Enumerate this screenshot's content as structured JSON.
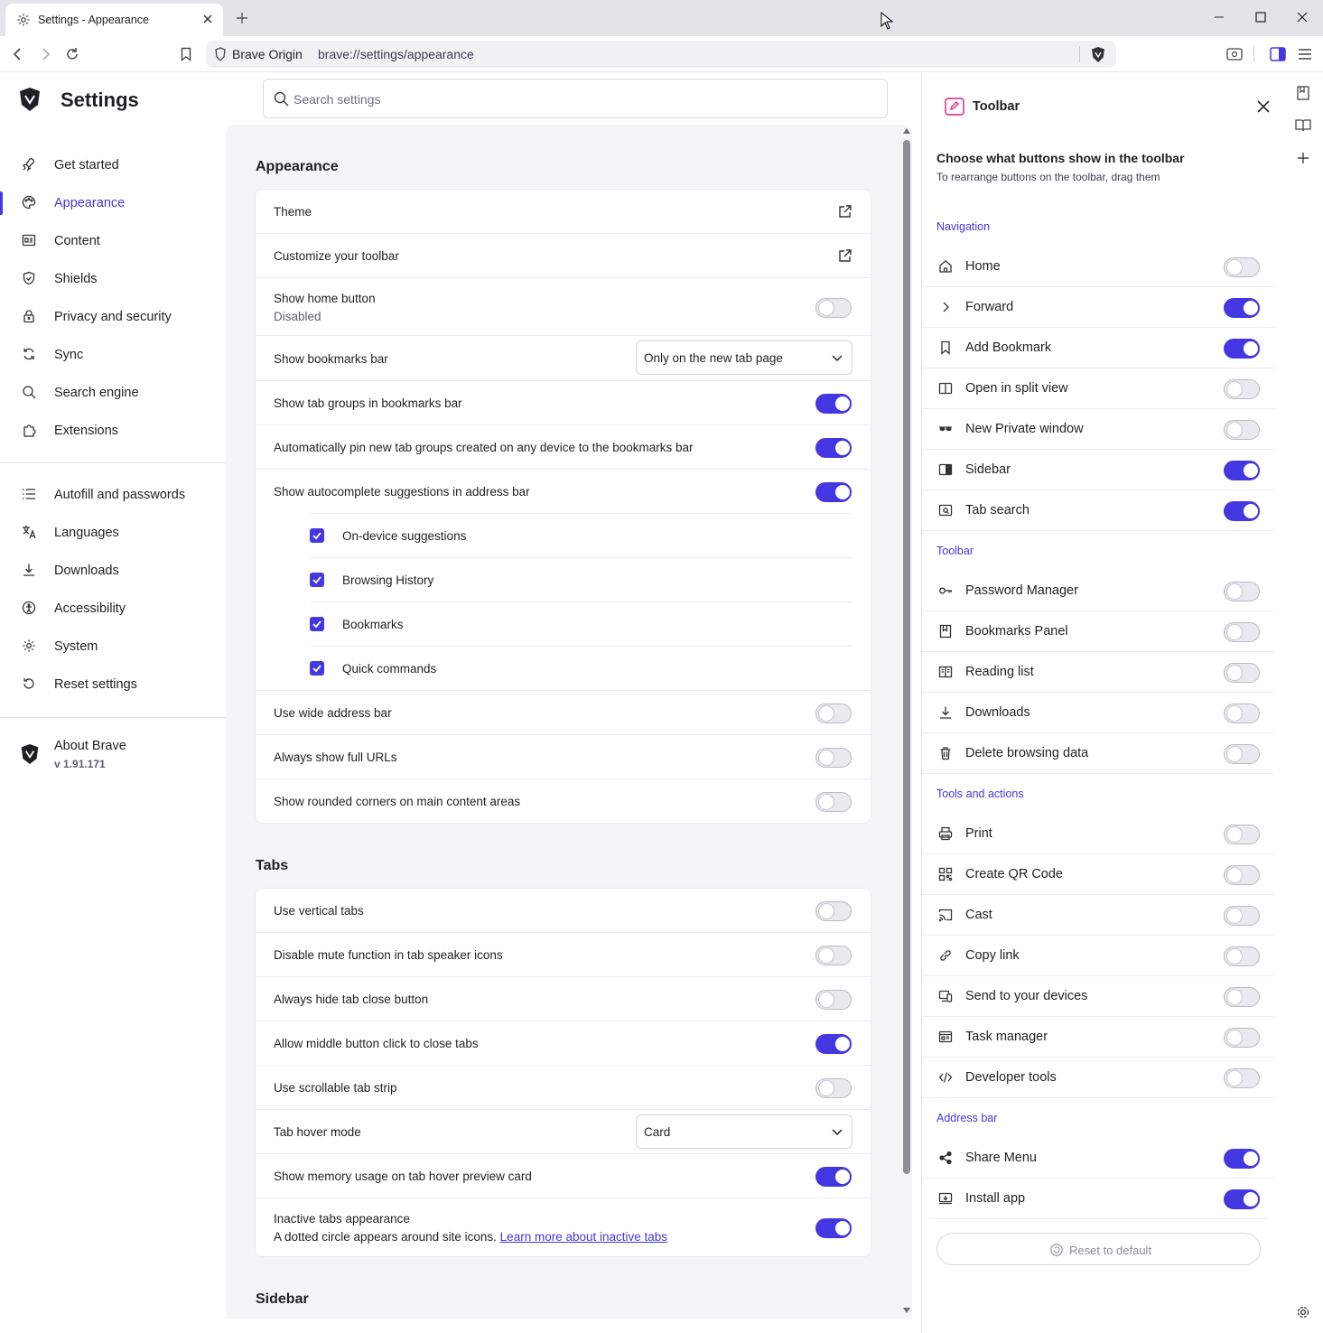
{
  "window": {
    "tab_title": "Settings - Appearance",
    "new_tab": "+"
  },
  "address_bar": {
    "brand": "Brave Origin",
    "url": "brave://settings/appearance"
  },
  "sidebar": {
    "title": "Settings",
    "items": [
      {
        "label": "Get started",
        "icon": "rocket-icon"
      },
      {
        "label": "Appearance",
        "icon": "palette-icon"
      },
      {
        "label": "Content",
        "icon": "content-icon"
      },
      {
        "label": "Shields",
        "icon": "shield-icon"
      },
      {
        "label": "Privacy and security",
        "icon": "lock-icon"
      },
      {
        "label": "Sync",
        "icon": "sync-icon"
      },
      {
        "label": "Search engine",
        "icon": "search-icon"
      },
      {
        "label": "Extensions",
        "icon": "puzzle-icon"
      },
      {
        "label": "Autofill and passwords",
        "icon": "list-icon"
      },
      {
        "label": "Languages",
        "icon": "translate-icon"
      },
      {
        "label": "Downloads",
        "icon": "download-icon"
      },
      {
        "label": "Accessibility",
        "icon": "accessibility-icon"
      },
      {
        "label": "System",
        "icon": "gear-icon"
      },
      {
        "label": "Reset settings",
        "icon": "reset-icon"
      }
    ],
    "about": {
      "label": "About Brave",
      "version": "v 1.91.171"
    }
  },
  "search": {
    "placeholder": "Search settings"
  },
  "appearance": {
    "heading": "Appearance",
    "theme": "Theme",
    "customize_toolbar": "Customize your toolbar",
    "show_home": "Show home button",
    "show_home_sub": "Disabled",
    "show_bookmarks_bar": "Show bookmarks bar",
    "bookmarks_bar_value": "Only on the new tab page",
    "tab_groups_bookmarks": "Show tab groups in bookmarks bar",
    "auto_pin": "Automatically pin new tab groups created on any device to the bookmarks bar",
    "autocomplete": "Show autocomplete suggestions in address bar",
    "on_device": "On-device suggestions",
    "history": "Browsing History",
    "bookmarks": "Bookmarks",
    "quick_commands": "Quick commands",
    "wide_address": "Use wide address bar",
    "full_urls": "Always show full URLs",
    "rounded_corners": "Show rounded corners on main content areas"
  },
  "tabs": {
    "heading": "Tabs",
    "vertical": "Use vertical tabs",
    "disable_mute": "Disable mute function in tab speaker icons",
    "hide_close": "Always hide tab close button",
    "middle_click": "Allow middle button click to close tabs",
    "scrollable": "Use scrollable tab strip",
    "hover_mode": "Tab hover mode",
    "hover_mode_value": "Card",
    "memory_usage": "Show memory usage on tab hover preview card",
    "inactive": "Inactive tabs appearance",
    "inactive_sub": "A dotted circle appears around site icons.",
    "inactive_link": "Learn more about inactive tabs"
  },
  "sidebar_section": {
    "heading": "Sidebar"
  },
  "panel": {
    "title": "Toolbar",
    "choose": "Choose what buttons show in the toolbar",
    "rearrange": "To rearrange buttons on the toolbar, drag them",
    "groups": {
      "navigation": "Navigation",
      "toolbar": "Toolbar",
      "tools": "Tools and actions",
      "address": "Address bar"
    },
    "items": [
      {
        "label": "Home",
        "icon": "home-icon",
        "on": false
      },
      {
        "label": "Forward",
        "icon": "chevron-right-icon",
        "on": true
      },
      {
        "label": "Add Bookmark",
        "icon": "bookmark-icon",
        "on": true
      },
      {
        "label": "Open in split view",
        "icon": "split-view-icon",
        "on": false
      },
      {
        "label": "New Private window",
        "icon": "private-glasses-icon",
        "on": false
      },
      {
        "label": "Sidebar",
        "icon": "sidebar-icon",
        "on": true
      },
      {
        "label": "Tab search",
        "icon": "tab-search-icon",
        "on": true
      },
      {
        "label": "Password Manager",
        "icon": "key-icon",
        "on": false
      },
      {
        "label": "Bookmarks Panel",
        "icon": "bookmarks-panel-icon",
        "on": false
      },
      {
        "label": "Reading list",
        "icon": "reading-list-icon",
        "on": false
      },
      {
        "label": "Downloads",
        "icon": "download-icon",
        "on": false
      },
      {
        "label": "Delete browsing data",
        "icon": "trash-icon",
        "on": false
      },
      {
        "label": "Print",
        "icon": "printer-icon",
        "on": false
      },
      {
        "label": "Create QR Code",
        "icon": "qr-code-icon",
        "on": false
      },
      {
        "label": "Cast",
        "icon": "cast-icon",
        "on": false
      },
      {
        "label": "Copy link",
        "icon": "link-icon",
        "on": false
      },
      {
        "label": "Send to your devices",
        "icon": "devices-icon",
        "on": false
      },
      {
        "label": "Task manager",
        "icon": "task-manager-icon",
        "on": false
      },
      {
        "label": "Developer tools",
        "icon": "code-icon",
        "on": false
      },
      {
        "label": "Share Menu",
        "icon": "share-icon",
        "on": true
      },
      {
        "label": "Install app",
        "icon": "install-app-icon",
        "on": true
      }
    ],
    "reset": "Reset to default"
  },
  "colors": {
    "accent": "#4436e1",
    "toggle_off": "#e9e9ee",
    "page_bg": "#f5f5f7"
  }
}
